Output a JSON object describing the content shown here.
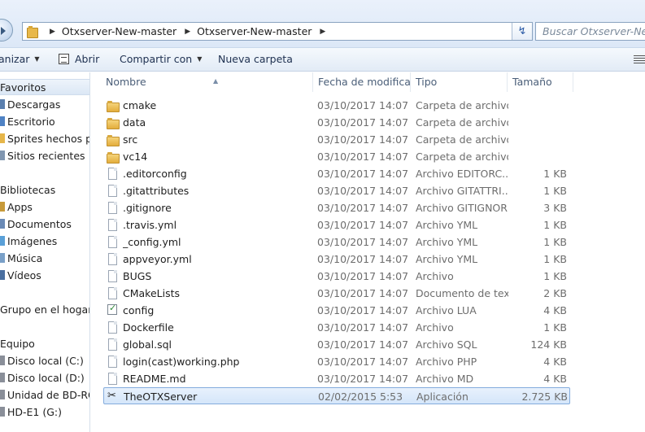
{
  "address_bar": {
    "crumbs": [
      "Otxserver-New-master",
      "Otxserver-New-master"
    ],
    "search_placeholder": "Buscar Otxserver-New-m"
  },
  "toolbar": {
    "organize_label": "anizar",
    "open_label": "Abrir",
    "share_label": "Compartir con",
    "new_folder_label": "Nueva carpeta"
  },
  "nav_pane": {
    "favorites_label": "Favoritos",
    "favorites": [
      "Descargas",
      "Escritorio",
      "Sprites hechos por",
      "Sitios recientes"
    ],
    "libraries_label": "Bibliotecas",
    "libraries": [
      "Apps",
      "Documentos",
      "Imágenes",
      "Música",
      "Vídeos"
    ],
    "homegroup_label": "Grupo en el hogar",
    "computer_label": "Equipo",
    "drives": [
      "Disco local (C:)",
      "Disco local (D:)",
      "Unidad de BD-ROM",
      "HD-E1 (G:)"
    ]
  },
  "columns": {
    "name": "Nombre",
    "date": "Fecha de modifica...",
    "type": "Tipo",
    "size": "Tamaño"
  },
  "files": [
    {
      "name": "cmake",
      "date": "03/10/2017 14:07",
      "type": "Carpeta de archivos",
      "size": "",
      "icon": "folder-icon"
    },
    {
      "name": "data",
      "date": "03/10/2017 14:07",
      "type": "Carpeta de archivos",
      "size": "",
      "icon": "folder-icon"
    },
    {
      "name": "src",
      "date": "03/10/2017 14:07",
      "type": "Carpeta de archivos",
      "size": "",
      "icon": "folder-icon"
    },
    {
      "name": "vc14",
      "date": "03/10/2017 14:07",
      "type": "Carpeta de archivos",
      "size": "",
      "icon": "folder-icon"
    },
    {
      "name": ".editorconfig",
      "date": "03/10/2017 14:07",
      "type": "Archivo EDITORC...",
      "size": "1 KB",
      "icon": "file-icon"
    },
    {
      "name": ".gitattributes",
      "date": "03/10/2017 14:07",
      "type": "Archivo GITATTRI...",
      "size": "1 KB",
      "icon": "file-icon"
    },
    {
      "name": ".gitignore",
      "date": "03/10/2017 14:07",
      "type": "Archivo GITIGNORE",
      "size": "3 KB",
      "icon": "file-icon"
    },
    {
      "name": ".travis.yml",
      "date": "03/10/2017 14:07",
      "type": "Archivo YML",
      "size": "1 KB",
      "icon": "file-icon"
    },
    {
      "name": "_config.yml",
      "date": "03/10/2017 14:07",
      "type": "Archivo YML",
      "size": "1 KB",
      "icon": "file-icon"
    },
    {
      "name": "appveyor.yml",
      "date": "03/10/2017 14:07",
      "type": "Archivo YML",
      "size": "1 KB",
      "icon": "file-icon"
    },
    {
      "name": "BUGS",
      "date": "03/10/2017 14:07",
      "type": "Archivo",
      "size": "1 KB",
      "icon": "file-icon"
    },
    {
      "name": "CMakeLists",
      "date": "03/10/2017 14:07",
      "type": "Documento de tex...",
      "size": "2 KB",
      "icon": "file-icon"
    },
    {
      "name": "config",
      "date": "03/10/2017 14:07",
      "type": "Archivo LUA",
      "size": "4 KB",
      "icon": "lua-file-icon"
    },
    {
      "name": "Dockerfile",
      "date": "03/10/2017 14:07",
      "type": "Archivo",
      "size": "1 KB",
      "icon": "file-icon"
    },
    {
      "name": "global.sql",
      "date": "03/10/2017 14:07",
      "type": "Archivo SQL",
      "size": "124 KB",
      "icon": "file-icon"
    },
    {
      "name": "login(cast)working.php",
      "date": "03/10/2017 14:07",
      "type": "Archivo PHP",
      "size": "4 KB",
      "icon": "file-icon"
    },
    {
      "name": "README.md",
      "date": "03/10/2017 14:07",
      "type": "Archivo MD",
      "size": "4 KB",
      "icon": "file-icon"
    },
    {
      "name": "TheOTXServer",
      "date": "02/02/2015 5:53",
      "type": "Aplicación",
      "size": "2.725 KB",
      "icon": "application-icon",
      "selected": true
    }
  ]
}
